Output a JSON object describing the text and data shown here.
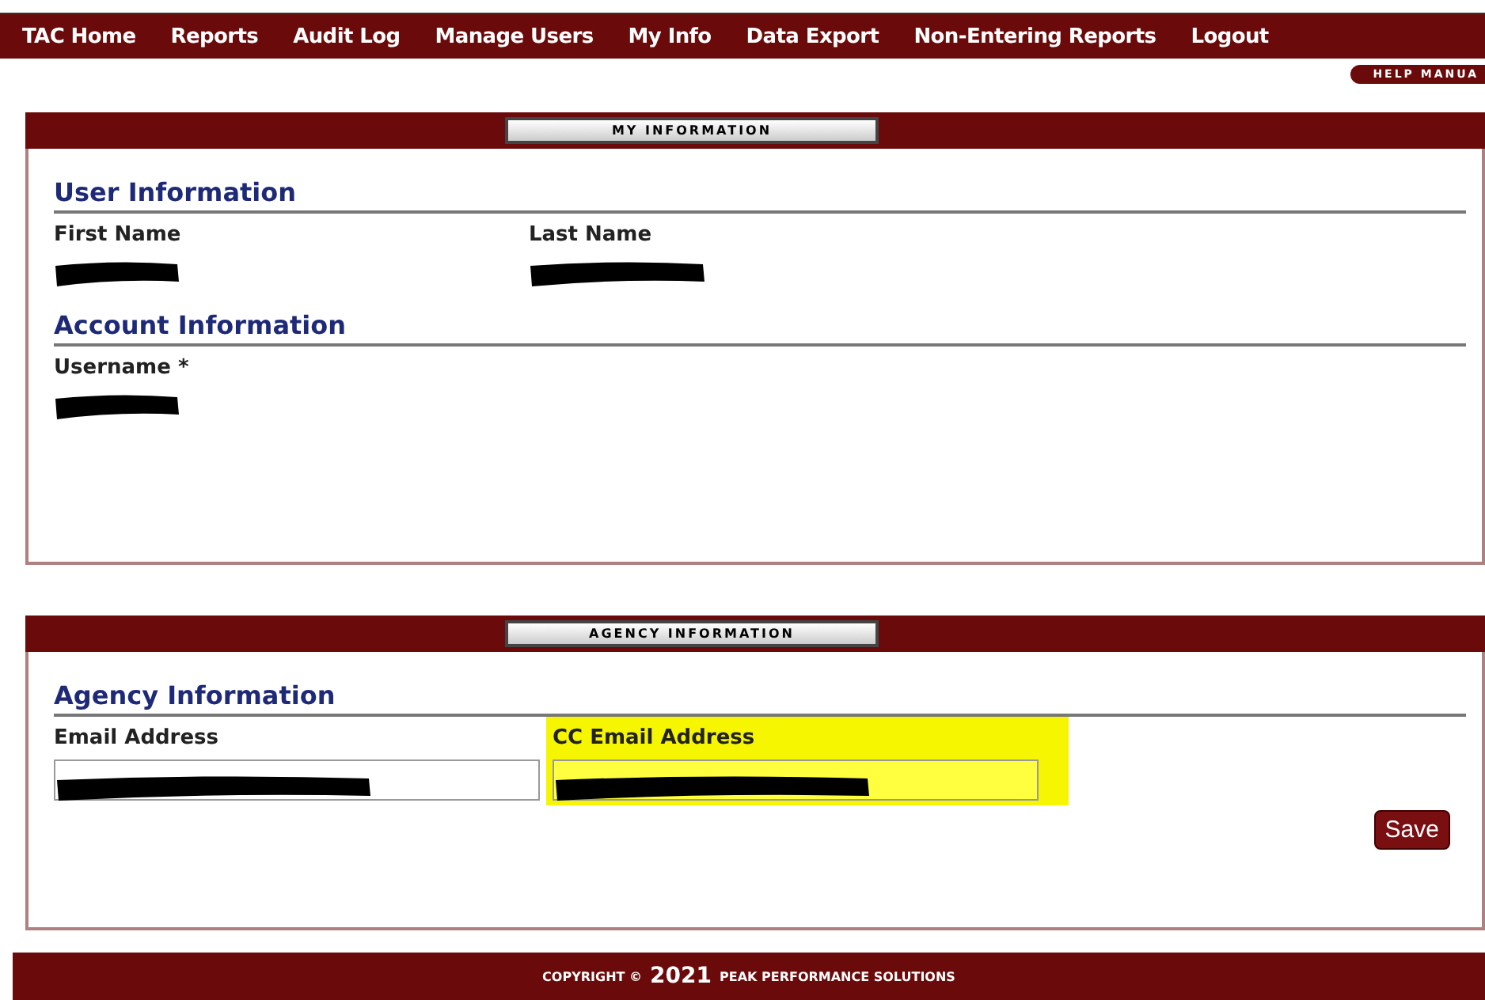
{
  "nav": {
    "items": [
      "TAC Home",
      "Reports",
      "Audit Log",
      "Manage Users",
      "My Info",
      "Data Export",
      "Non-Entering Reports",
      "Logout"
    ]
  },
  "help_tab": "HELP MANUA",
  "panels": [
    {
      "header": "MY INFORMATION",
      "sections": [
        {
          "title": "User Information",
          "fields": [
            {
              "label": "First Name",
              "kind": "readonly",
              "redacted": true
            },
            {
              "label": "Last Name",
              "kind": "readonly",
              "redacted": true
            }
          ]
        },
        {
          "title": "Account Information",
          "fields": [
            {
              "label": "Username *",
              "kind": "readonly",
              "redacted": true
            }
          ]
        }
      ]
    },
    {
      "header": "AGENCY INFORMATION",
      "sections": [
        {
          "title": "Agency Information",
          "fields": [
            {
              "label": "Email Address",
              "kind": "input",
              "redacted": true,
              "highlighted": false
            },
            {
              "label": "CC Email Address",
              "kind": "input",
              "redacted": true,
              "highlighted": true
            }
          ]
        }
      ],
      "button": "Save"
    }
  ],
  "footer": {
    "prefix": "COPYRIGHT ©",
    "year": "2021",
    "suffix": "PEAK PERFORMANCE SOLUTIONS"
  }
}
